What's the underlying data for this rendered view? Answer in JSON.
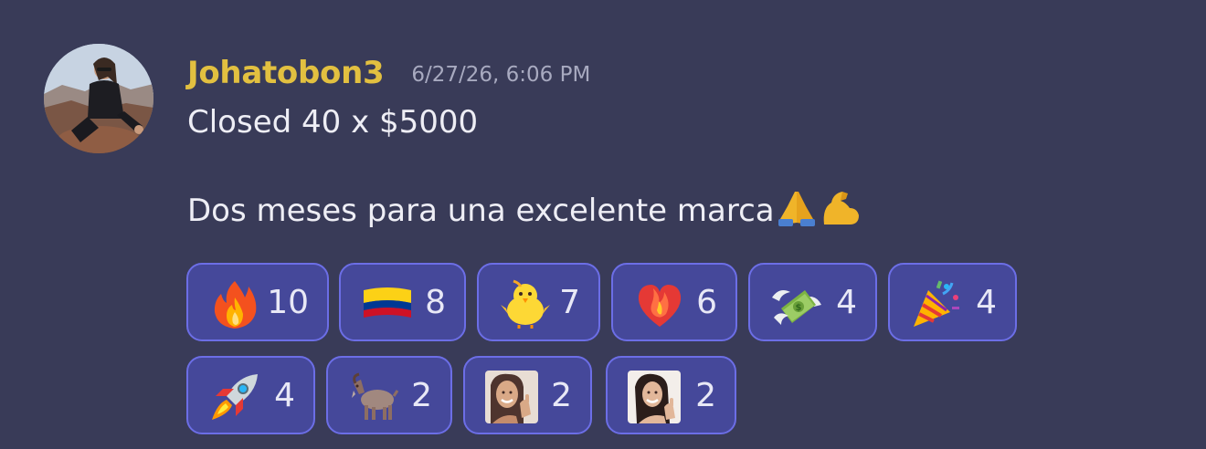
{
  "message": {
    "author": "Johatobon3",
    "timestamp": "6/27/26, 6:06 PM",
    "lines": [
      "Closed 40 x $5000",
      "",
      "Dos meses para una excelente marca"
    ],
    "inline_emojis": [
      "folded-hands-icon",
      "flexed-biceps-icon"
    ]
  },
  "reactions": [
    {
      "icon": "fire-icon",
      "count": "10"
    },
    {
      "icon": "colombia-flag-icon",
      "count": "8"
    },
    {
      "icon": "baby-chick-icon",
      "count": "7"
    },
    {
      "icon": "heart-on-fire-icon",
      "count": "6"
    },
    {
      "icon": "money-with-wings-icon",
      "count": "4"
    },
    {
      "icon": "party-popper-icon",
      "count": "4"
    },
    {
      "icon": "rocket-icon",
      "count": "4"
    },
    {
      "icon": "goat-icon",
      "count": "2"
    },
    {
      "icon": "custom-photo-emoji-1",
      "count": "2"
    },
    {
      "icon": "custom-photo-emoji-2",
      "count": "2"
    }
  ],
  "colors": {
    "background": "#393b58",
    "username": "#e2c040",
    "reaction_border": "#6c6ee6",
    "reaction_fill": "#45489a"
  }
}
